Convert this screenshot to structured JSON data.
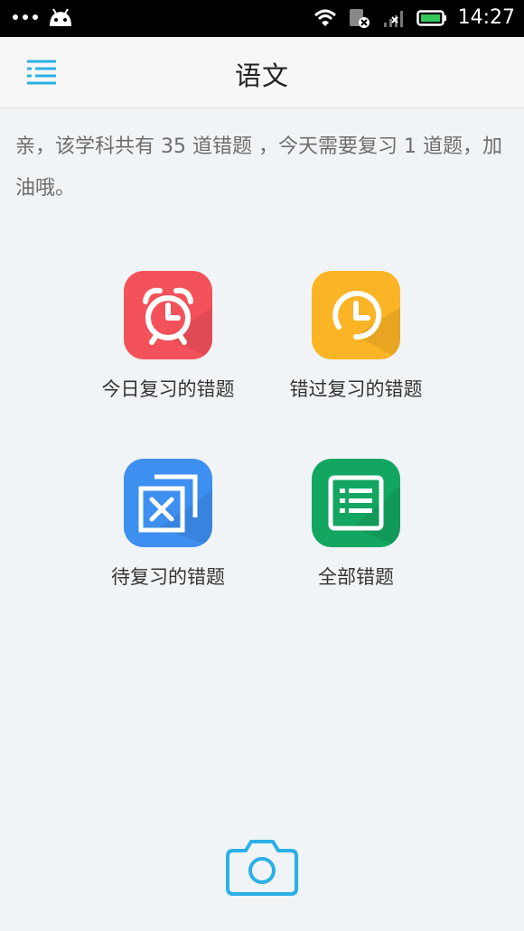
{
  "status_bar": {
    "time": "14:27",
    "icons": [
      "more-dots-icon",
      "android-icon",
      "wifi-icon",
      "sim-card-icon",
      "signal-icon",
      "battery-icon"
    ]
  },
  "app_bar": {
    "title": "语文",
    "menu_icon": "list-menu-icon"
  },
  "info_text": "亲，该学科共有 35 道错题 ，今天需要复习 1 道题，加油哦。",
  "tiles": [
    {
      "label": "今日复习的错题",
      "icon": "alarm-clock-icon",
      "color": "#f4525b"
    },
    {
      "label": "错过复习的错题",
      "icon": "clock-icon",
      "color": "#fbb425"
    },
    {
      "label": "待复习的错题",
      "icon": "delete-box-icon",
      "color": "#3d8ff0"
    },
    {
      "label": "全部错题",
      "icon": "list-icon",
      "color": "#13a661"
    }
  ],
  "camera_icon": "camera-icon",
  "colors": {
    "accent": "#2bb0e6",
    "background": "#f1f4f7"
  }
}
